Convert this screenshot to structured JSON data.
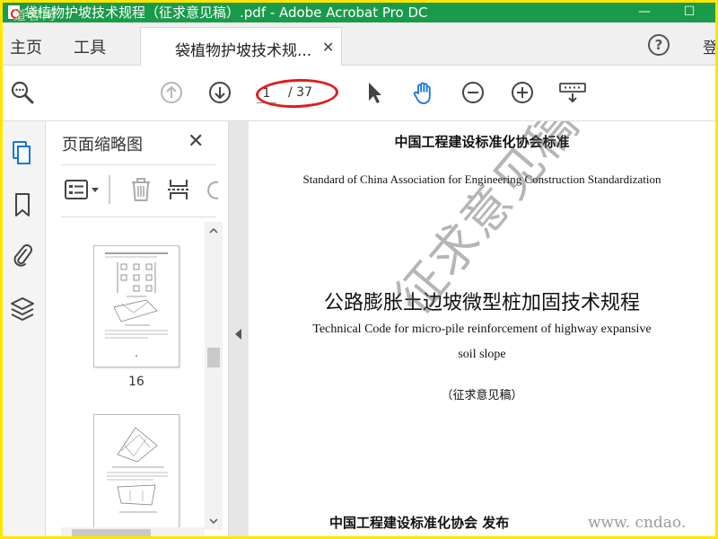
{
  "window": {
    "title": "袋植物护坡技术规程（征求意见稿）.pdf - Adobe Acrobat Pro DC",
    "watermark": "道客网",
    "minimize": "—",
    "maximize": "☐"
  },
  "menubar": {
    "home": "主页",
    "tools": "工具",
    "tab_label": "袋植物护坡技术规...",
    "tab_close": "✕",
    "help": "?",
    "signin": "登"
  },
  "toolbar": {
    "current_page": "1",
    "total_pages": "/ 37",
    "highlight_color": "#e11b1b"
  },
  "thumbnail_panel": {
    "title": "页面缩略图",
    "close": "✕",
    "pages": [
      {
        "number": "16"
      },
      {
        "number": ""
      }
    ]
  },
  "document": {
    "association_cn": "中国工程建设标准化协会标准",
    "association_en": "Standard of China Association for Engineering Construction Standardization",
    "title_cn": "公路膨胀土边坡微型桩加固技术规程",
    "title_en_line1": "Technical Code for micro-pile reinforcement of highway expansive",
    "title_en_line2": "soil slope",
    "draft_note": "（征求意见稿）",
    "publisher": "中国工程建设标准化协会 发布",
    "stamp": "征求意见稿",
    "site_watermark": "www. cndao. com"
  },
  "colors": {
    "titlebar": "#1a9a4b",
    "accent": "#1473e6",
    "frame": "#ffe600"
  }
}
